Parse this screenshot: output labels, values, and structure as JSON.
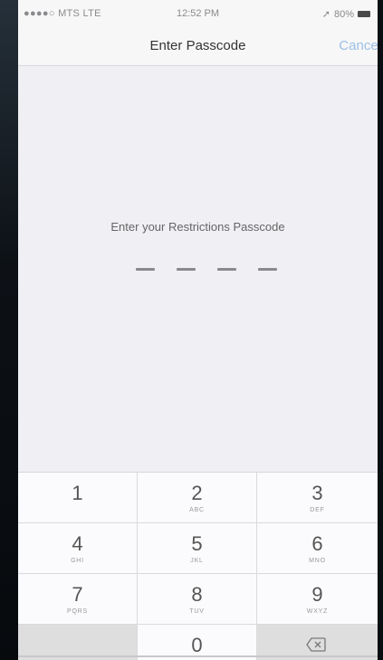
{
  "status_bar": {
    "carrier": "●●●●○ MTS  LTE",
    "time": "12:52 PM",
    "battery_percent": "80%"
  },
  "nav": {
    "title": "Enter Passcode",
    "cancel_label": "Cancel"
  },
  "prompt": "Enter your Restrictions Passcode",
  "passcode": {
    "length": 4,
    "entered": 0
  },
  "keypad": [
    {
      "digit": "1",
      "letters": ""
    },
    {
      "digit": "2",
      "letters": "ABC"
    },
    {
      "digit": "3",
      "letters": "DEF"
    },
    {
      "digit": "4",
      "letters": "GHI"
    },
    {
      "digit": "5",
      "letters": "JKL"
    },
    {
      "digit": "6",
      "letters": "MNO"
    },
    {
      "digit": "7",
      "letters": "PQRS"
    },
    {
      "digit": "8",
      "letters": "TUV"
    },
    {
      "digit": "9",
      "letters": "WXYZ"
    },
    {
      "digit": "0",
      "letters": ""
    }
  ],
  "icons": [
    "location-icon",
    "battery-icon",
    "delete-icon"
  ],
  "colors": {
    "accent": "#9bbfe8",
    "background": "#efeff4",
    "keypad": "#fbfbfd"
  }
}
